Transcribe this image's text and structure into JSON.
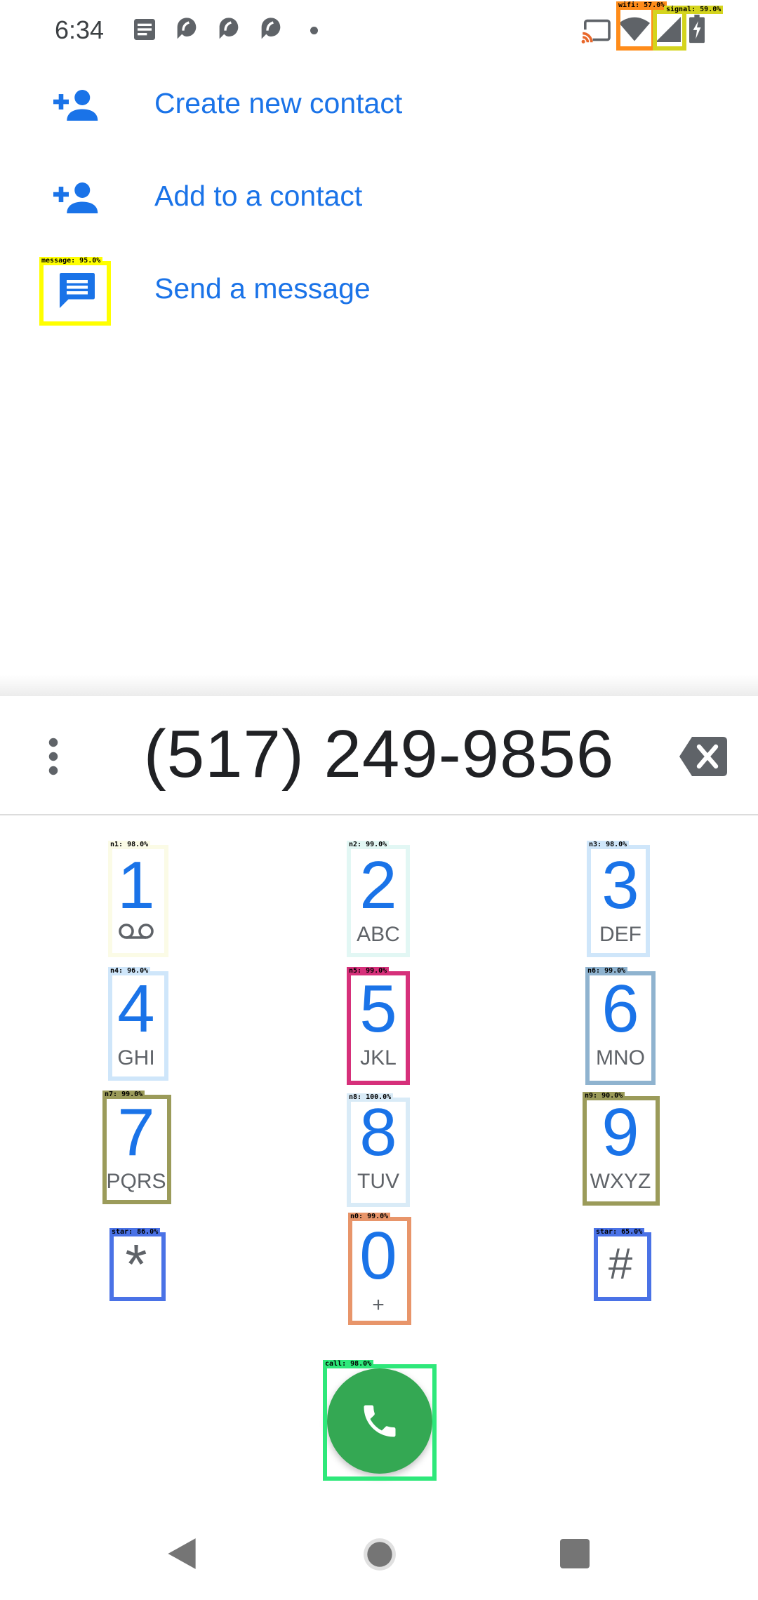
{
  "status_bar": {
    "time": "6:34",
    "icons": [
      "news-icon",
      "pin-icon",
      "pin-icon",
      "pin-icon",
      "dot-icon",
      "cast-icon",
      "wifi-icon",
      "signal-icon",
      "battery-charging-icon"
    ]
  },
  "actions": [
    {
      "label": "Create new contact",
      "icon": "person-add-icon"
    },
    {
      "label": "Add to a contact",
      "icon": "person-add-icon"
    },
    {
      "label": "Send a message",
      "icon": "message-icon"
    }
  ],
  "dialpad": {
    "number": "(517) 249-9856",
    "keys": [
      {
        "digit": "1",
        "letters": "",
        "has_voicemail": true
      },
      {
        "digit": "2",
        "letters": "ABC"
      },
      {
        "digit": "3",
        "letters": "DEF"
      },
      {
        "digit": "4",
        "letters": "GHI"
      },
      {
        "digit": "5",
        "letters": "JKL"
      },
      {
        "digit": "6",
        "letters": "MNO"
      },
      {
        "digit": "7",
        "letters": "PQRS"
      },
      {
        "digit": "8",
        "letters": "TUV"
      },
      {
        "digit": "9",
        "letters": "WXYZ"
      },
      {
        "digit": "*",
        "letters": ""
      },
      {
        "digit": "0",
        "letters": "+"
      },
      {
        "digit": "#",
        "letters": ""
      }
    ]
  },
  "detections": [
    {
      "label": "wifi: 57.0%",
      "color": "#ff8c1a"
    },
    {
      "label": "signal: 59.0%",
      "color": "#d4d41e"
    },
    {
      "label": "message: 95.0%",
      "color": "#ffff00"
    },
    {
      "label": "n1: 98.0%",
      "color": "#fbfbe6"
    },
    {
      "label": "n2: 99.0%",
      "color": "#e2f7f4"
    },
    {
      "label": "n3: 98.0%",
      "color": "#cfe6fa"
    },
    {
      "label": "n4: 96.0%",
      "color": "#cfe6fa"
    },
    {
      "label": "n5: 99.0%",
      "color": "#d6307a"
    },
    {
      "label": "n6: 99.0%",
      "color": "#8fb3cf"
    },
    {
      "label": "n7: 99.0%",
      "color": "#9b9b5a"
    },
    {
      "label": "n8: 100.0%",
      "color": "#d9ebf7"
    },
    {
      "label": "n9: 90.0%",
      "color": "#9b9b5a"
    },
    {
      "label": "star: 86.0%",
      "color": "#4a72e6"
    },
    {
      "label": "n0: 99.0%",
      "color": "#e8956a"
    },
    {
      "label": "star: 65.0%",
      "color": "#4a72e6"
    },
    {
      "label": "call: 98.0%",
      "color": "#2ee87a"
    }
  ],
  "colors": {
    "accent": "#1a73e8",
    "call_green": "#34a853",
    "text_primary": "#202124",
    "text_secondary": "#5f6368"
  },
  "nav_bar": {
    "icons": [
      "back-icon",
      "home-icon",
      "recents-icon"
    ]
  }
}
